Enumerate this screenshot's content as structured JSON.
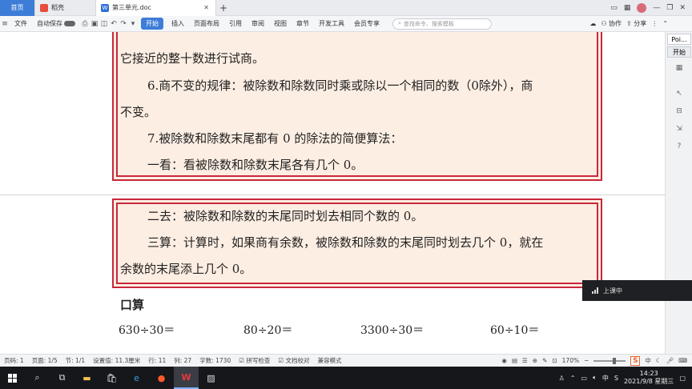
{
  "tabs": {
    "home": "首页",
    "store": "稻壳",
    "doc": "第三单元.doc"
  },
  "ribbon": {
    "file": "文件",
    "autosave": "自动保存",
    "items": [
      "开始",
      "插入",
      "页面布局",
      "引用",
      "审阅",
      "视图",
      "章节",
      "开发工具",
      "会员专享"
    ],
    "search_placeholder": "查找命令、搜索模板",
    "collab": "协作",
    "share": "分享"
  },
  "document": {
    "box1_lines": [
      "它接近的整十数进行试商。",
      "6.商不变的规律：被除数和除数同时乘或除以一个相同的数（0除外），商",
      "不变。",
      "7.被除数和除数末尾都有 0 的除法的简便算法：",
      "一看：看被除数和除数末尾各有几个 0。"
    ],
    "box2_lines": [
      "二去：被除数和除数的末尾同时划去相同个数的 0。",
      "三算：计算时，如果商有余数，被除数和除数的末尾同时划去几个 0，就在",
      "余数的末尾添上几个 0。"
    ],
    "subhead": "口算",
    "calcs": [
      "630÷30＝",
      "80÷20＝",
      "3300÷30＝",
      "60÷10＝"
    ]
  },
  "right_panel": {
    "tab1": "Poi...",
    "tab2": "开始"
  },
  "float_widget": {
    "label": "上课中"
  },
  "status": {
    "page_num": "页码: 1",
    "pages": "页面: 1/5",
    "section": "节: 1/1",
    "position": "设置值: 11.3厘米",
    "row": "行: 11",
    "col": "列: 27",
    "words": "字数: 1730",
    "spell": "拼写检查",
    "proof": "文档校对",
    "compat": "兼容模式",
    "zoom": "170%",
    "ime": "中"
  },
  "taskbar": {
    "time": "14:23",
    "date": "2021/9/8 星期三",
    "ime": "中"
  }
}
